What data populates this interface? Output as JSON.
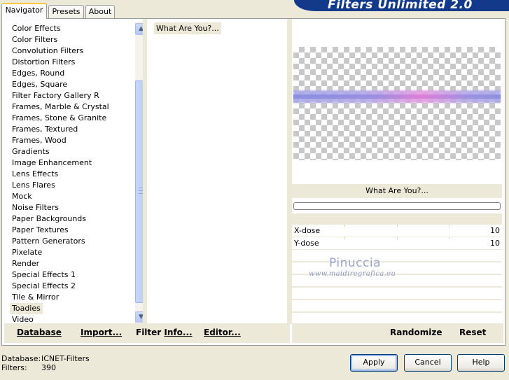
{
  "tabs": [
    "Navigator",
    "Presets",
    "About"
  ],
  "banner": "Filters Unlimited 2.0",
  "categories": [
    "Color Effects",
    "Color Filters",
    "Convolution Filters",
    "Distortion Filters",
    "Edges, Round",
    "Edges, Square",
    "Filter Factory Gallery R",
    "Frames, Marble & Crystal",
    "Frames, Stone & Granite",
    "Frames, Textured",
    "Frames, Wood",
    "Gradients",
    "Image Enhancement",
    "Lens Effects",
    "Lens Flares",
    "Mock",
    "Noise Filters",
    "Paper Backgrounds",
    "Paper Textures",
    "Pattern Generators",
    "Pixelate",
    "Render",
    "Special Effects 1",
    "Special Effects 2",
    "Tile & Mirror",
    "Toadies",
    "Video"
  ],
  "selected_category": "Toadies",
  "filters": [
    "What Are You?..."
  ],
  "selected_filter_title": "What Are You?...",
  "params": [
    {
      "label": "X-dose",
      "value": "10"
    },
    {
      "label": "Y-dose",
      "value": "10"
    }
  ],
  "watermark": {
    "name": "Pinuccia",
    "site": "www.maidiregrafica.eu"
  },
  "bottom_left": {
    "database": {
      "u": "D",
      "rest": "atabase"
    },
    "import": {
      "u": "I",
      "rest": "mport..."
    },
    "filter_info": {
      "pre": "Filter ",
      "u": "I",
      "rest": "nfo..."
    },
    "editor": {
      "u": "E",
      "rest": "ditor..."
    }
  },
  "bottom_right": {
    "randomize": "Randomize",
    "reset": "Reset"
  },
  "info": {
    "database_key": "Database:",
    "database_val": "ICNET-Filters",
    "filters_key": "Filters:",
    "filters_val": "390"
  },
  "buttons": {
    "apply": "Apply",
    "cancel": "Cancel",
    "help": "Help"
  }
}
